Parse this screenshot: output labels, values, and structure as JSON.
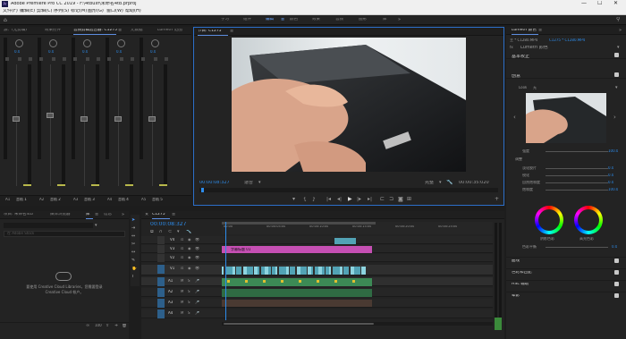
{
  "window": {
    "title": "Adobe Premiere Pro CC 2019 - F:\\4tbuxf\\未命名4tb.prproj"
  },
  "menu": [
    "文件(F)",
    "编辑(E)",
    "剪辑(C)",
    "序列(S)",
    "标记(M)",
    "图形(G)",
    "窗口(W)",
    "帮助(H)"
  ],
  "workspaces": [
    {
      "label": "学习",
      "active": false
    },
    {
      "label": "组件",
      "active": false
    },
    {
      "label": "编辑",
      "active": true
    },
    {
      "label": "颜色",
      "active": false
    },
    {
      "label": "效果",
      "active": false
    },
    {
      "label": "音频",
      "active": false
    },
    {
      "label": "图形",
      "active": false
    },
    {
      "label": "库",
      "active": false
    }
  ],
  "mixer": {
    "tabs": [
      "源：(无剪辑)",
      "效果控件",
      "音频剪辑混合器: C1275",
      "元数据",
      "Lumetri 范围"
    ],
    "channels": [
      {
        "id": "A1",
        "name": "音轨 1"
      },
      {
        "id": "A2",
        "name": "音轨 2"
      },
      {
        "id": "A3",
        "name": "音轨 3"
      },
      {
        "id": "A4",
        "name": "音轨 4"
      },
      {
        "id": "A5",
        "name": "音轨 5"
      }
    ],
    "value": "0.0"
  },
  "program": {
    "title": "节目: C1275",
    "timecode": "00:00:08:327",
    "fit": "适合",
    "quality": "完整",
    "duration": "00:00:35:020"
  },
  "project": {
    "tabs": [
      "项目: 未命名4tb",
      "媒体浏览器",
      "库",
      "信息"
    ],
    "search": "在 Adobe Stock",
    "cloud_message": "要使用 Creative Cloud Libraries，您需要登录 Creative Cloud 帐户。",
    "zoom": "100"
  },
  "timeline": {
    "seq": "C1275",
    "timecode": "00:00:08:327",
    "ruler": [
      "00:00",
      "00:00:05:00",
      "00:00:10:00",
      "00:00:15:00",
      "00:00:20:00",
      "00:00:25:00"
    ],
    "tracks": [
      "V4",
      "V3",
      "V2",
      "V1",
      "A1",
      "A2",
      "A3",
      "A4"
    ],
    "title_clip": "字幕标题 01"
  },
  "lumetri": {
    "tab": "Lumetri 颜色",
    "source": "主 * C1280.MP4",
    "link": "C1275 * C1280.MP4",
    "effect": "Lumetri 颜色",
    "sections": [
      "基本校正",
      "创意"
    ],
    "look_label": "Look",
    "look_value": "无",
    "sliders": [
      {
        "label": "强度",
        "value": "100.0"
      },
      {
        "label": "调整",
        "value": ""
      },
      {
        "label": "淡化胶片",
        "value": "0.0"
      },
      {
        "label": "锐化",
        "value": "0.0"
      },
      {
        "label": "自然饱和度",
        "value": "0.0"
      },
      {
        "label": "饱和度",
        "value": "100.0"
      }
    ],
    "wheels": [
      "阴影色彩",
      "高光色彩"
    ],
    "balance_label": "色彩平衡",
    "balance_value": "0.0",
    "bottom_sections": [
      "曲线",
      "色轮和匹配",
      "HSL 辅助",
      "晕影"
    ]
  },
  "colors": {
    "accent": "#2d8ceb",
    "video_clip": "#52a3b5",
    "audio_clip": "#3c8a55",
    "title_clip": "#c54fb3"
  }
}
